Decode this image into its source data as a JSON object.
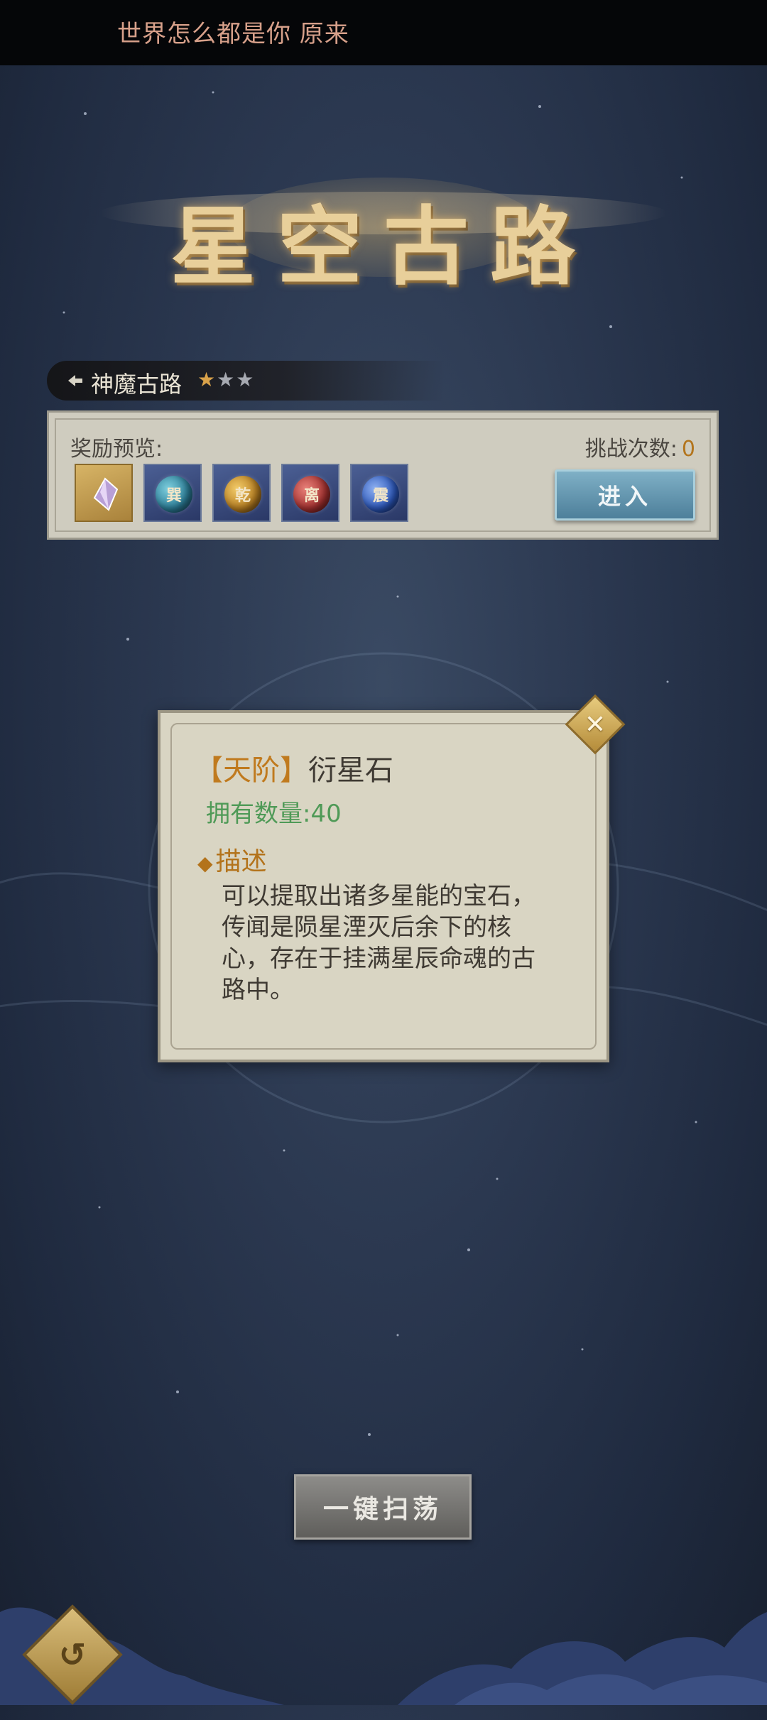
{
  "marquee": {
    "text": "世界怎么都是你 原来"
  },
  "title": {
    "text": "星空古路"
  },
  "stage": {
    "name": "神魔古路",
    "stars_total": 3,
    "stars_earned": 1
  },
  "reward_panel": {
    "label": "奖励预览:",
    "challenge_label": "挑战次数:",
    "challenge_count": "0",
    "enter_label": "进入",
    "items": [
      {
        "icon": "star-crystal-icon",
        "glyph": ""
      },
      {
        "icon": "orb-icon",
        "glyph": "巽"
      },
      {
        "icon": "orb-icon",
        "glyph": "乾"
      },
      {
        "icon": "orb-icon",
        "glyph": "离"
      },
      {
        "icon": "orb-icon",
        "glyph": "震"
      }
    ]
  },
  "popup": {
    "tier": "【天阶】",
    "item_name": "衍星石",
    "owned": "拥有数量:40",
    "desc_heading": "描述",
    "desc_text": "可以提取出诸多星能的宝石，传闻是陨星湮灭后余下的核心，存在于挂满星辰命魂的古路中。",
    "close_symbol": "✕"
  },
  "sweep_button": {
    "label": "一键扫荡"
  },
  "colors": {
    "gold": "#d9a24a",
    "tier": "#c07a1e",
    "owned": "#4f9a57"
  }
}
